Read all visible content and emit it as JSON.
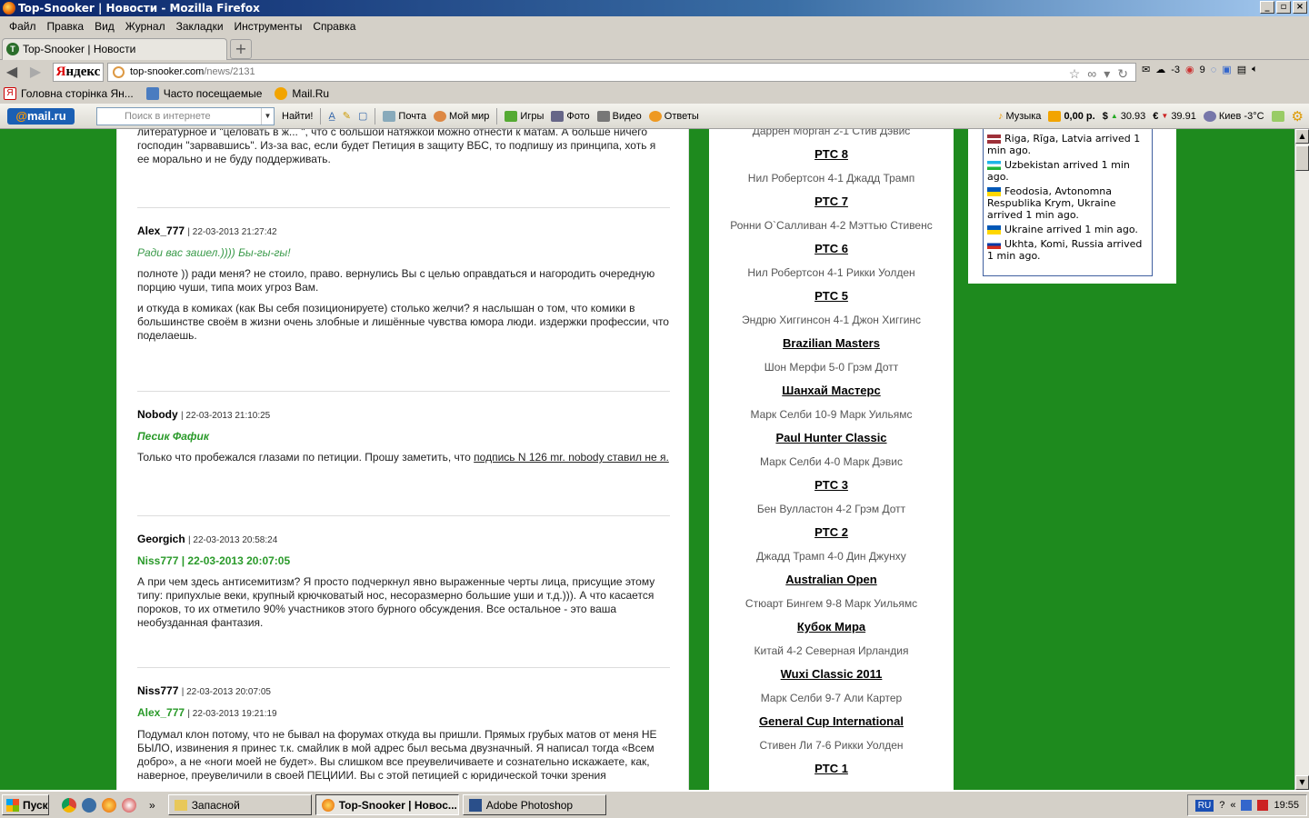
{
  "window": {
    "title": "Top-Snooker | Новости - Mozilla Firefox"
  },
  "menu": [
    "Файл",
    "Правка",
    "Вид",
    "Журнал",
    "Закладки",
    "Инструменты",
    "Справка"
  ],
  "tab": {
    "label": "Top-Snooker | Новости",
    "icon_text": "T"
  },
  "nav": {
    "yandex_prefix": "Я",
    "yandex_rest": "ндекс",
    "url_host": "top-snooker.com",
    "url_path": "/news/2131",
    "mail_count": "",
    "weather": "-3",
    "notif_count": "9"
  },
  "bookmarks": [
    "Головна сторінка Ян...",
    "Часто посещаемые",
    "Mail.Ru"
  ],
  "mailbar": {
    "logo_at": "@",
    "logo_mail": "mail",
    "logo_ru": ".ru",
    "search_placeholder": "Поиск в интернете",
    "find_label": "Найти!",
    "links": [
      "Почта",
      "Мой мир",
      "Игры",
      "Фото",
      "Видео",
      "Ответы"
    ],
    "music": "Музыка",
    "balance": "0,00 р.",
    "usd": "30.93",
    "eur": "39.91",
    "weather_city": "Киев -3°C"
  },
  "comments_top_fragment": [
    "литературное и \"целовать в ж... \", что с большой натяжкой можно отнести к матам. А больше ничего",
    "господин \"зарвавшись\". Из-за вас, если будет Петиция в защиту ВБС, то подпишу из принципа, хоть я",
    "ее морально и не буду поддерживать."
  ],
  "comments": [
    {
      "author": "Alex_777",
      "date": "| 22-03-2013 21:27:42",
      "quote": "Ради вас зашел.)))) Бы-гы-гы!",
      "paragraphs": [
        "полноте )) ради меня? не стоило, право. вернулись Вы с целью оправдаться и нагородить очередную порцию чуши, типа моих угроз Вам.",
        "и откуда в комиках (как Вы себя позиционируете) столько желчи? я наслышан о том, что комики в большинстве своём в жизни очень злобные и лишённые чувства юмора люди. издержки профессии, что поделаешь."
      ]
    },
    {
      "author": "Nobody",
      "date": "| 22-03-2013 21:10:25",
      "quote": "Песик Фафик",
      "text_before_link": "Только что пробежался глазами по петиции. Прошу заметить, что ",
      "link": "подпись N 126 mr. nobody ставил не я."
    },
    {
      "author": "Georgich",
      "date": "| 22-03-2013 20:58:24",
      "quote_author": "Niss777 | 22-03-2013 20:07:05",
      "paragraphs": [
        "А при чем здесь антисемитизм? Я просто подчеркнул явно выраженные черты лица, присущие этому типу: припухлые веки, крупный крючковатый нос, несоразмерно большие уши и т.д.))). А что касается пороков, то их отметило 90% участников этого бурного обсуждения. Все остальное - это ваша необузданная фантазия."
      ]
    },
    {
      "author": "Niss777",
      "date": "| 22-03-2013 20:07:05",
      "quote_author_name": "Alex_777",
      "quote_author_date": "| 22-03-2013 19:21:19",
      "paragraphs": [
        "Подумал клон потому, что не бывал на форумах откуда вы пришли. Прямых грубых матов от меня НЕ БЫЛО, извинения я принес т.к. смайлик в мой адрес был весьма двузначный.  Я написал тогда «Всем добро», а не «ноги моей не будет». Вы слишком все преувеличиваете и сознательно искажаете, как, наверное, преувеличили в своей ПЕЦИИИ. Вы с этой петицией с юридической точки зрения"
      ]
    }
  ],
  "results": [
    {
      "line": "Даррен Морган 2-1 Стив Дэвис"
    },
    {
      "title": "PTC 8",
      "line": "Нил Робертсон 4-1 Джадд Трамп"
    },
    {
      "title": "PTC 7",
      "line": "Ронни О`Салливан 4-2 Мэттью Стивенс"
    },
    {
      "title": "PTC 6",
      "line": "Нил Робертсон 4-1 Рикки Уолден"
    },
    {
      "title": "PTC 5",
      "line": "Эндрю Хиггинсон 4-1 Джон Хиггинс"
    },
    {
      "title": "Brazilian Masters",
      "line": "Шон Мерфи 5-0 Грэм Дотт"
    },
    {
      "title": "Шанхай Мастерс",
      "line": "Марк Селби 10-9 Марк Уильямс"
    },
    {
      "title": "Paul Hunter Classic",
      "line": "Марк Селби 4-0 Марк Дэвис"
    },
    {
      "title": "PTC 3",
      "line": "Бен Вулластон 4-2 Грэм Дотт"
    },
    {
      "title": "PTC 2",
      "line": "Джадд Трамп 4-0 Дин Джунху"
    },
    {
      "title": "Australian Open",
      "line": "Стюарт Бингем 9-8 Марк Уильямс"
    },
    {
      "title": "Кубок Мира",
      "line": "Китай 4-2 Северная Ирландия"
    },
    {
      "title": "Wuxi Classic 2011",
      "line": "Марк Селби 9-7 Али Картер"
    },
    {
      "title": "General Cup International",
      "line": "Стивен Ли 7-6 Рикки Уолден"
    },
    {
      "title": "PTC 1",
      "line": ""
    }
  ],
  "visitors": [
    {
      "text": "Riga, Rīga, Latvia arrived 1 min ago.",
      "flag": "lv"
    },
    {
      "text": "Uzbekistan arrived 1 min ago.",
      "flag": "uz"
    },
    {
      "text": "Feodosia, Avtonomna Respublika Krym, Ukraine arrived 1 min ago.",
      "flag": "ua"
    },
    {
      "text": "Ukraine arrived 1 min ago.",
      "flag": "ua"
    },
    {
      "text": "Ukhta, Komi, Russia arrived 1 min ago.",
      "flag": "ru"
    }
  ],
  "taskbar": {
    "start": "Пуск",
    "tasks": [
      "Запасной",
      "Top-Snooker | Новос...",
      "Adobe Photoshop"
    ],
    "lang": "RU",
    "time": "19:55"
  },
  "colors": {
    "page_bg": "#1e8a1e",
    "quote_green": "#2a9a2a",
    "titlebar": "#0a246a"
  }
}
